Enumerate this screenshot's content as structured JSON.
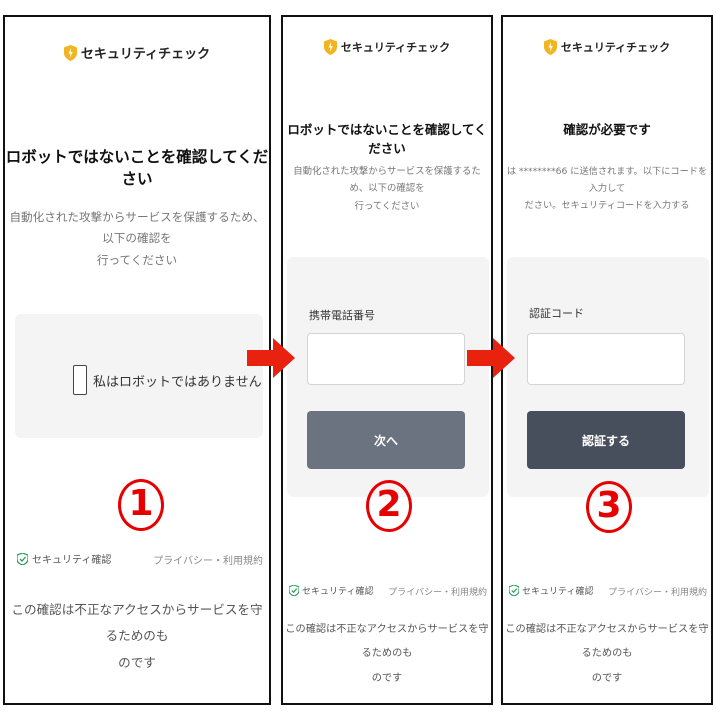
{
  "panels": [
    {
      "header": "セキュリティチェック",
      "title": "ロボットではないことを確認してください",
      "desc_line1": "自動化された攻撃からサービスを保護するため、以下の確認を",
      "desc_line2": "行ってください",
      "checkbox_label": "私はロボットではありません",
      "step_number": "1",
      "footer_left": "セキュリティ確認",
      "footer_right": "プライバシー・利用規約",
      "note_line1": "この確認は不正なアクセスからサービスを守るためのも",
      "note_line2": "のです"
    },
    {
      "header": "セキュリティチェック",
      "title": "ロボットではないことを確認してください",
      "desc_line1": "自動化された攻撃からサービスを保護するため、以下の確認を",
      "desc_line2": "行ってください",
      "field_label": "携帯電話番号",
      "field_value": "",
      "button_label": "次へ",
      "step_number": "2",
      "footer_left": "セキュリティ確認",
      "footer_right": "プライバシー・利用規約",
      "note_line1": "この確認は不正なアクセスからサービスを守るためのも",
      "note_line2": "のです"
    },
    {
      "header": "セキュリティチェック",
      "title": "確認が必要です",
      "desc_line1": "は ********66 に送信されます。以下にコードを入力して",
      "desc_line2": "ださい。セキュリティコードを入力する",
      "field_label": "認証コード",
      "field_value": "",
      "button_label": "認証する",
      "step_number": "3",
      "footer_left": "セキュリティ確認",
      "footer_right": "プライバシー・利用規約",
      "note_line1": "この確認は不正なアクセスからサービスを守るためのも",
      "note_line2": "のです"
    }
  ],
  "colors": {
    "accent_shield": "#f2b51f",
    "button_step2": "#6b7280",
    "button_step3": "#474e5c",
    "step_number": "#e60000",
    "arrow": "#e8220f",
    "check_icon": "#2a9d5c"
  }
}
